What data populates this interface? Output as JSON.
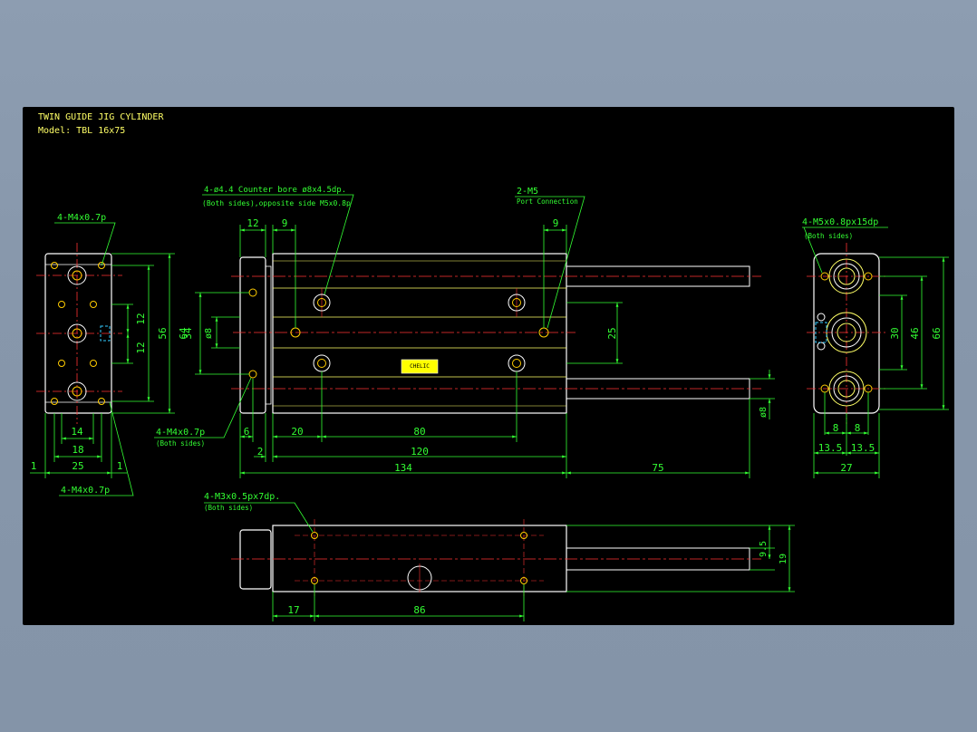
{
  "title": {
    "line1": "TWIN GUIDE JIG CYLINDER",
    "line2": "Model: TBL 16x75"
  },
  "colors": {
    "background": "#000000",
    "outline": "#ffffff",
    "body_lines": "#ffff66",
    "centerline": "#ff3333",
    "dimension": "#33ff33",
    "hidden": "#33ccff",
    "hole": "#ffcc00",
    "title_text": "#ffff66"
  },
  "callouts": {
    "left_top": "4-M4x0.7p",
    "left_bottom": "4-M4x0.7p",
    "front_counterbore": "4-ø4.4 Counter bore ø8x4.5dp.",
    "front_counterbore_sub": "(Both sides),opposite side M5x0.8p",
    "port_main": "2-M5",
    "port_sub": "Port Connection",
    "front_rod_holes": "4-M4x0.7p",
    "front_rod_holes_sub": "(Both sides)",
    "right_holes": "4-M5x0.8px15dp",
    "right_holes_sub": "(Both sides)",
    "bottom_holes": "4-M3x0.5px7dp.",
    "bottom_holes_sub": "(Both sides)",
    "label_plate": "CHELIC"
  },
  "dims": {
    "left": {
      "d56": "56",
      "d64": "64",
      "d12a": "12",
      "d12b": "12",
      "d14": "14",
      "d18": "18",
      "d25": "25",
      "d1a": "1",
      "d1b": "1"
    },
    "front": {
      "d12": "12",
      "d9a": "9",
      "d9b": "9",
      "d34": "34",
      "d8": "ø8",
      "d25": "25",
      "d8rod": "ø8",
      "d6": "6",
      "d20": "20",
      "d80": "80",
      "d2": "2",
      "d120": "120",
      "d134": "134",
      "d75": "75"
    },
    "right": {
      "d30": "30",
      "d46": "46",
      "d66": "66",
      "d8a": "8",
      "d8b": "8",
      "d135a": "13.5",
      "d135b": "13.5",
      "d27": "27"
    },
    "bottom": {
      "d95": "9.5",
      "d19": "19",
      "d17": "17",
      "d86": "86"
    }
  }
}
